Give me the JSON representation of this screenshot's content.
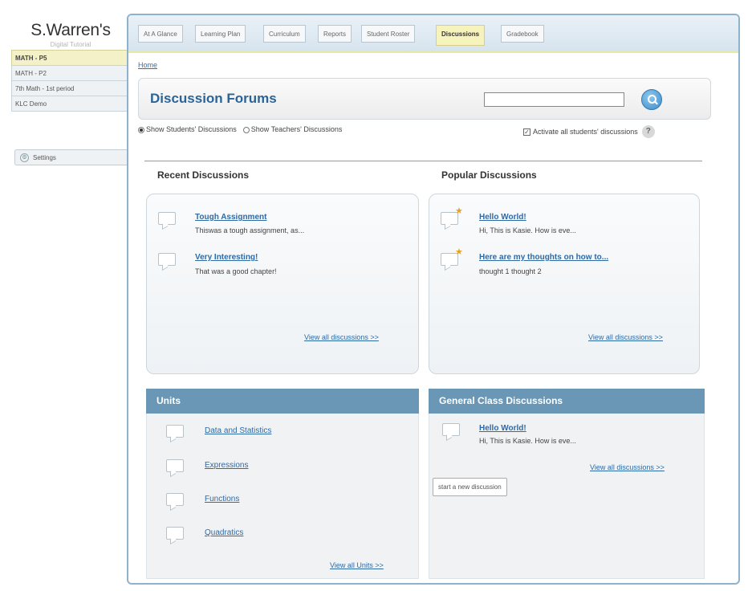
{
  "brand": {
    "title": "S.Warren's",
    "subtitle": "Digital Tutorial"
  },
  "classes": [
    {
      "label": "MATH - P5",
      "active": true
    },
    {
      "label": "MATH - P2",
      "active": false
    },
    {
      "label": "7th Math - 1st period",
      "active": false
    },
    {
      "label": "KLC Demo",
      "active": false
    }
  ],
  "settings_label": "Settings",
  "tabs": [
    "At A Glance",
    "Learning Plan",
    "Curriculum",
    "Reports",
    "Student Roster",
    "Discussions",
    "Gradebook"
  ],
  "active_tab": "Discussions",
  "breadcrumb": "Home",
  "header": {
    "title": "Discussion Forums",
    "search_value": ""
  },
  "filters": {
    "show_students": "Show Students' Discussions",
    "show_teachers": "Show Teachers' Discussions",
    "selected": "students",
    "activate_label": "Activate all students' discussions",
    "activate_checked": true,
    "help": "?"
  },
  "recent": {
    "title": "Recent Discussions",
    "items": [
      {
        "title": "Tough Assignment",
        "snippet": "Thiswas a tough assignment, as..."
      },
      {
        "title": "Very Interesting!",
        "snippet": "That was a good chapter!"
      }
    ],
    "view_all": "View all discussions >>"
  },
  "popular": {
    "title": "Popular Discussions",
    "items": [
      {
        "title": "Hello World!",
        "snippet": "Hi, This is Kasie. How is eve..."
      },
      {
        "title": "Here are my thoughts on how to...",
        "snippet": "thought 1 thought 2"
      }
    ],
    "view_all": "View all discussions >>"
  },
  "units": {
    "title": "Units",
    "items": [
      "Data and Statistics",
      "Expressions",
      "Functions",
      "Quadratics"
    ],
    "view_all": "View all Units >>"
  },
  "general": {
    "title": "General Class Discussions",
    "items": [
      {
        "title": "Hello World!",
        "snippet": "Hi, This is Kasie. How is eve..."
      }
    ],
    "view_all": "View all discussions >>",
    "new_button": "start a new discussion"
  },
  "colors": {
    "accent": "#2b6496",
    "tab_active": "#f7f3bd",
    "box_header": "#6a97b5",
    "frame": "#8fb2cc"
  }
}
